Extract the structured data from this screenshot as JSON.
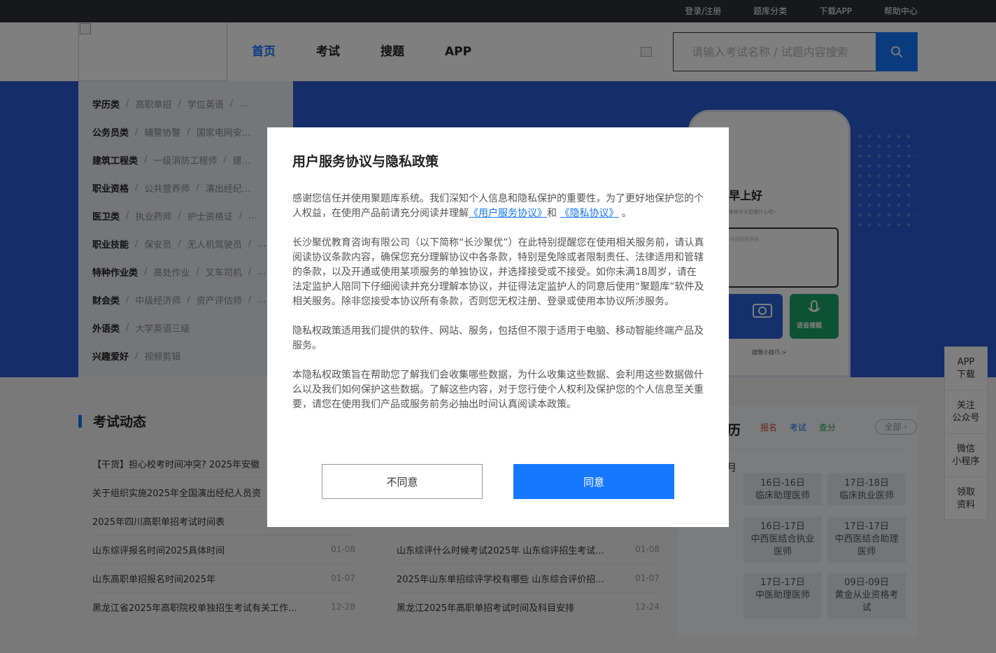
{
  "topbar": {
    "links": [
      "登录/注册",
      "题库分类",
      "下载APP",
      "帮助中心"
    ]
  },
  "header": {
    "nav": [
      "首页",
      "考试",
      "搜题",
      "APP"
    ],
    "search_placeholder": "请输入考试名称 / 试题内容搜索",
    "search_icon": "search-icon"
  },
  "categories": [
    {
      "name": "学历类",
      "subs": [
        "高职单招",
        "学位英语",
        "..."
      ]
    },
    {
      "name": "公务员类",
      "subs": [
        "辅警协警",
        "国家电网安..."
      ]
    },
    {
      "name": "建筑工程类",
      "subs": [
        "一级消防工程师",
        "建..."
      ]
    },
    {
      "name": "职业资格",
      "subs": [
        "公共营养师",
        "演出经纪..."
      ]
    },
    {
      "name": "医卫类",
      "subs": [
        "执业药师",
        "护士资格证",
        "..."
      ]
    },
    {
      "name": "职业技能",
      "subs": [
        "保安员",
        "无人机驾驶员",
        "..."
      ]
    },
    {
      "name": "特种作业类",
      "subs": [
        "高处作业",
        "叉车司机",
        "..."
      ]
    },
    {
      "name": "财会类",
      "subs": [
        "中级经济师",
        "资产评估师",
        "..."
      ]
    },
    {
      "name": "外语类",
      "subs": [
        "大学英语三级"
      ]
    },
    {
      "name": "兴趣爱好",
      "subs": [
        "视频剪辑"
      ]
    }
  ],
  "phone": {
    "greeting": "早上好",
    "hint": "来你今天想搜什么吧~",
    "input_hint": "内容搜索答案",
    "voice_label": "语音搜题",
    "tips": "搜题小技巧 >"
  },
  "news": {
    "title": "考试动态",
    "left": [
      {
        "title": "【干货】担心校考时间冲突? 2025年安徽",
        "date": ""
      },
      {
        "title": "关于组织实施2025年全国演出经纪人员资",
        "date": ""
      },
      {
        "title": "2025年四川高职单招考试时间表",
        "date": ""
      },
      {
        "title": "山东综评报名时间2025具体时间",
        "date": "01-08"
      },
      {
        "title": "山东高职单招报名时间2025年",
        "date": "01-07"
      },
      {
        "title": "黑龙江省2025年高职院校单独招生考试有关工作...",
        "date": "12-28"
      }
    ],
    "right": [
      {
        "title": "山东综评什么时候考试2025年 山东综评招生考试...",
        "date": "01-08"
      },
      {
        "title": "2025年山东单招综评学校有哪些 山东综合评价招...",
        "date": "01-07"
      },
      {
        "title": "黑龙江2025年高职单招考试时间及科目安排",
        "date": "12-24"
      }
    ]
  },
  "calendar": {
    "title": "日历",
    "tags": [
      {
        "label": "报名",
        "color": "#e0453a"
      },
      {
        "label": "考试",
        "color": "#1677ff"
      },
      {
        "label": "查分",
        "color": "#2aa55a"
      }
    ],
    "all_label": "全部",
    "month": "月",
    "cards": [
      {
        "date": "16日-16日",
        "name": "临床助理医师"
      },
      {
        "date": "17日-18日",
        "name": "临床执业医师"
      },
      {
        "date": "16日-17日",
        "name": "中西医结合执业医师"
      },
      {
        "date": "17日-17日",
        "name": "中西医结合助理医师"
      },
      {
        "date": "17日-17日",
        "name": "中医助理医师"
      },
      {
        "date": "09日-09日",
        "name": "黄金从业资格考试"
      }
    ]
  },
  "side": [
    "APP下载",
    "关注公众号",
    "微信小程序",
    "领取资料"
  ],
  "modal": {
    "title": "用户服务协议与隐私政策",
    "p1_a": "感谢您信任并使用聚题库系统。我们深知个人信息和隐私保护的重要性，为了更好地保护您的个人权益，在使用产品前请充分阅读并理解",
    "link1": "《用户服务协议》",
    "p1_and": "和",
    "link2": "《隐私协议》",
    "p1_end": "。",
    "p2": "长沙聚优教育咨询有限公司（以下简称“长沙聚优”）在此特别提醒您在使用相关服务前，请认真阅读协议条款内容，确保您充分理解协议中各条款，特别是免除或者限制责任、法律适用和管辖的条款，以及开通或使用某项服务的单独协议，并选择接受或不接受。如你未满18周岁，请在法定监护人陪同下仔细阅读并充分理解本协议，并征得法定监护人的同意后使用“聚题库”软件及相关服务。除非您接受本协议所有条款，否则您无权注册、登录或使用本协议所涉服务。",
    "p3": "隐私权政策适用我们提供的软件、网站、服务，包括但不限于适用于电脑、移动智能终端产品及服务。",
    "p4": "本隐私权政策旨在帮助您了解我们会收集哪些数据，为什么收集这些数据、会利用这些数据做什么以及我们如何保护这些数据。了解这些内容，对于您行使个人权利及保护您的个人信息至关重要，请您在使用我们产品或服务前务必抽出时间认真阅读本政策。",
    "disagree": "不同意",
    "agree": "同意"
  }
}
